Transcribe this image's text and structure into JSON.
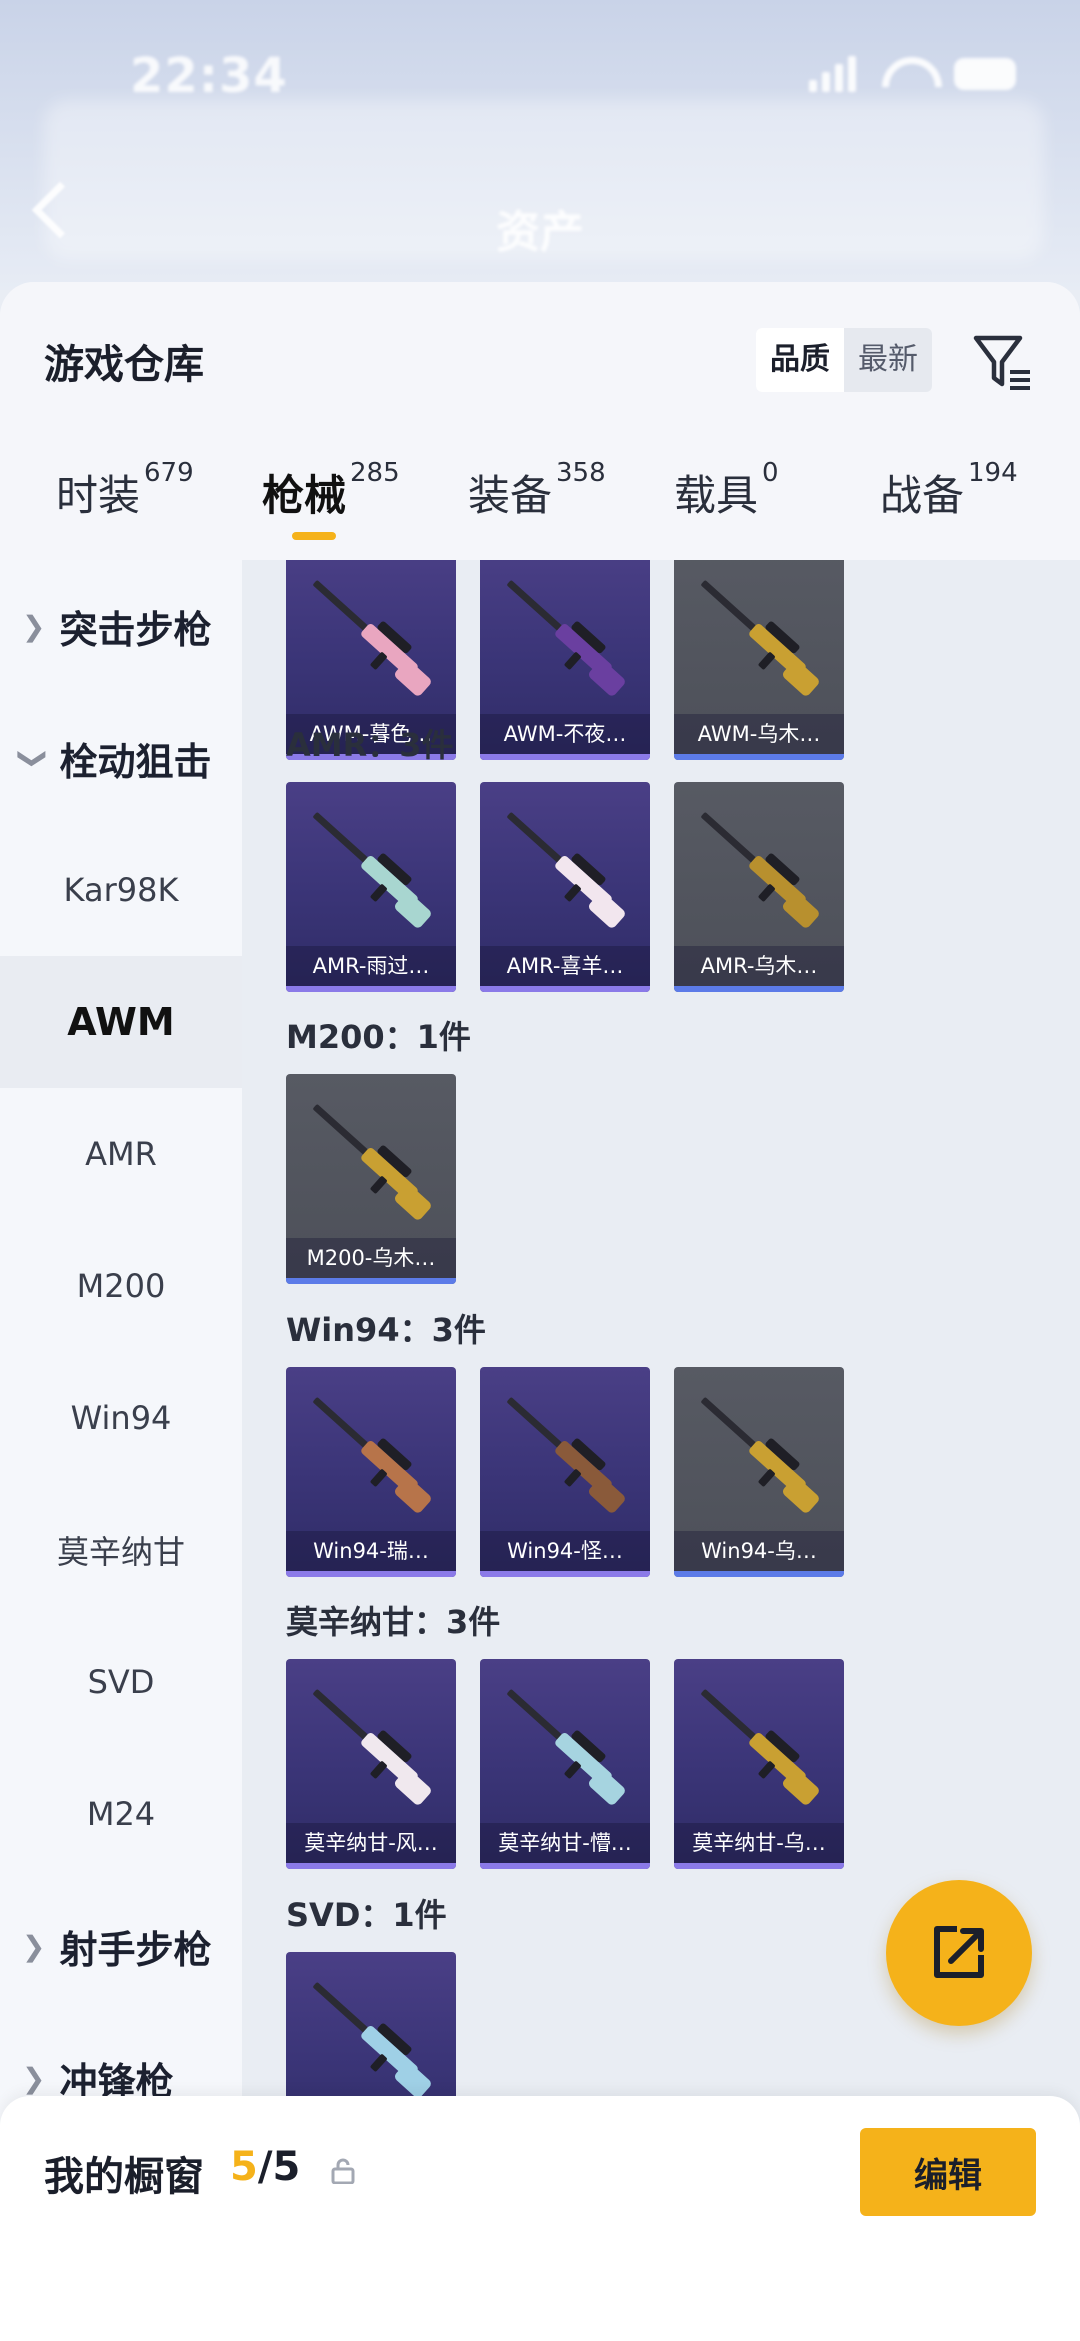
{
  "status_bar": {
    "time": "22:34"
  },
  "header": {
    "title": "资产"
  },
  "sheet": {
    "title": "游戏仓库",
    "sort_options": [
      "品质",
      "最新"
    ],
    "active_sort": "品质"
  },
  "tabs": [
    {
      "label": "时装",
      "count": "679",
      "active": false
    },
    {
      "label": "枪械",
      "count": "285",
      "active": true
    },
    {
      "label": "装备",
      "count": "358",
      "active": false
    },
    {
      "label": "载具",
      "count": "0",
      "active": false
    },
    {
      "label": "战备",
      "count": "194",
      "active": false
    }
  ],
  "sidebar": {
    "items": [
      {
        "label": "突击步枪",
        "type": "group",
        "expanded": false
      },
      {
        "label": "栓动狙击",
        "type": "group",
        "expanded": true
      },
      {
        "label": "Kar98K",
        "type": "sub"
      },
      {
        "label": "AWM",
        "type": "sub",
        "active": true
      },
      {
        "label": "AMR",
        "type": "sub"
      },
      {
        "label": "M200",
        "type": "sub"
      },
      {
        "label": "Win94",
        "type": "sub"
      },
      {
        "label": "莫辛纳甘",
        "type": "sub"
      },
      {
        "label": "SVD",
        "type": "sub"
      },
      {
        "label": "M24",
        "type": "sub"
      },
      {
        "label": "射手步枪",
        "type": "group",
        "expanded": false
      },
      {
        "label": "冲锋枪",
        "type": "group",
        "expanded": false
      }
    ]
  },
  "sections": [
    {
      "label": "",
      "items": [
        {
          "name": "AWM-暮色…",
          "rarity": "purple",
          "gun_color": "#e9a6c0"
        },
        {
          "name": "AWM-不夜…",
          "rarity": "purple",
          "gun_color": "#6a3fa0"
        },
        {
          "name": "AWM-乌木…",
          "rarity": "gray",
          "gun_color": "#c9a032"
        }
      ]
    },
    {
      "label": "AMR：3件",
      "items": [
        {
          "name": "AMR-雨过…",
          "rarity": "purple",
          "gun_color": "#a8d6d0"
        },
        {
          "name": "AMR-喜羊…",
          "rarity": "purple",
          "gun_color": "#f2e6ee"
        },
        {
          "name": "AMR-乌木…",
          "rarity": "gray",
          "gun_color": "#b8902e"
        }
      ]
    },
    {
      "label": "M200：1件",
      "items": [
        {
          "name": "M200-乌木…",
          "rarity": "gray",
          "gun_color": "#c9a032"
        }
      ]
    },
    {
      "label": "Win94：3件",
      "items": [
        {
          "name": "Win94-瑞…",
          "rarity": "purple",
          "gun_color": "#b7744a"
        },
        {
          "name": "Win94-怪…",
          "rarity": "purple",
          "gun_color": "#8a5a3a"
        },
        {
          "name": "Win94-乌…",
          "rarity": "gray",
          "gun_color": "#c9a032"
        }
      ]
    },
    {
      "label": "莫辛纳甘：3件",
      "items": [
        {
          "name": "莫辛纳甘-风…",
          "rarity": "purple",
          "gun_color": "#f0e8ee"
        },
        {
          "name": "莫辛纳甘-懵…",
          "rarity": "purple",
          "gun_color": "#a6d4e0"
        },
        {
          "name": "莫辛纳甘-乌…",
          "rarity": "purple",
          "gun_color": "#c9a032"
        }
      ]
    },
    {
      "label": "SVD：1件",
      "items": [
        {
          "name": "",
          "rarity": "purple",
          "gun_color": "#9fd0e6"
        }
      ]
    }
  ],
  "showcase": {
    "title": "我的橱窗",
    "current": "5",
    "total": "/5",
    "edit_label": "编辑"
  }
}
